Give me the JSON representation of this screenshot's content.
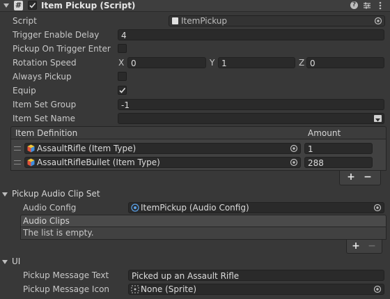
{
  "header": {
    "title": "Item Pickup (Script)",
    "enabled": true
  },
  "fields": {
    "script": {
      "label": "Script",
      "value": "ItemPickup"
    },
    "trigger_enable_delay": {
      "label": "Trigger Enable Delay",
      "value": "4"
    },
    "pickup_on_trigger_enter": {
      "label": "Pickup On Trigger Enter",
      "checked": false
    },
    "rotation_speed": {
      "label": "Rotation Speed",
      "x_label": "X",
      "x": "0",
      "y_label": "Y",
      "y": "1",
      "z_label": "Z",
      "z": "0"
    },
    "always_pickup": {
      "label": "Always Pickup",
      "checked": false
    },
    "equip": {
      "label": "Equip",
      "checked": true
    },
    "item_set_group": {
      "label": "Item Set Group",
      "value": "-1"
    },
    "item_set_name": {
      "label": "Item Set Name",
      "value": ""
    }
  },
  "item_list": {
    "col_definition": "Item Definition",
    "col_amount": "Amount",
    "rows": [
      {
        "definition": "AssaultRifle (Item Type)",
        "amount": "1"
      },
      {
        "definition": "AssaultRifleBullet (Item Type)",
        "amount": "288"
      }
    ],
    "add": "+",
    "remove": "−"
  },
  "audio": {
    "foldout": "Pickup Audio Clip Set",
    "config_label": "Audio Config",
    "config_value": "ItemPickup (Audio Config)",
    "clips_header": "Audio Clips",
    "empty_text": "The list is empty.",
    "add": "+",
    "remove": "−"
  },
  "ui": {
    "foldout": "UI",
    "message_text_label": "Pickup Message Text",
    "message_text_value": "Picked up an Assault Rifle",
    "message_icon_label": "Pickup Message Icon",
    "message_icon_value": "None (Sprite)"
  },
  "colors": {
    "background": "#383838",
    "field": "#2a2a2a",
    "text": "#d2d2d2"
  }
}
